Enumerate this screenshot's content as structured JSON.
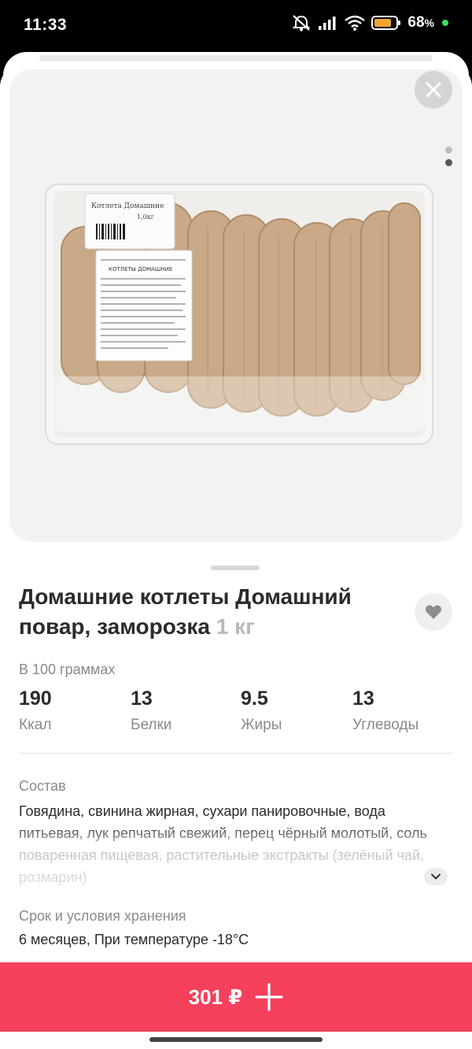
{
  "status_bar": {
    "time": "11:33",
    "battery": "68",
    "battery_unit": "%"
  },
  "product": {
    "title": "Домашние котлеты Домашний повар, заморозка",
    "weight": "1 кг",
    "image_pages": 2,
    "image_page_active": 2,
    "package_label_name": "Котлета Домашние",
    "package_label_weight": "1,0кг",
    "package_sticker_title": "КОТЛЕТЫ ДОМАШНИЕ"
  },
  "nutrition": {
    "heading": "В 100 граммах",
    "items": [
      {
        "value": "190",
        "label": "Ккал"
      },
      {
        "value": "13",
        "label": "Белки"
      },
      {
        "value": "9.5",
        "label": "Жиры"
      },
      {
        "value": "13",
        "label": "Углеводы"
      }
    ]
  },
  "composition": {
    "label": "Состав",
    "text": "Говядина, свинина жирная, сухари панировочные, вода питьевая, лук репчатый свежий, перец чёрный молотый, соль поваренная пищевая, растительные экстракты (зелёный чай, розмарин)"
  },
  "storage": {
    "label": "Срок и условия хранения",
    "text": "6 месяцев, При температуре -18°C"
  },
  "buy": {
    "price": "301 ₽"
  },
  "colors": {
    "accent": "#f4405c",
    "battery_fill": "#f2a533",
    "dot_green": "#3ddc5c"
  },
  "icons": {
    "close": "close-icon",
    "favorite": "heart-icon",
    "expand": "chevron-down-icon",
    "add": "plus-icon"
  }
}
